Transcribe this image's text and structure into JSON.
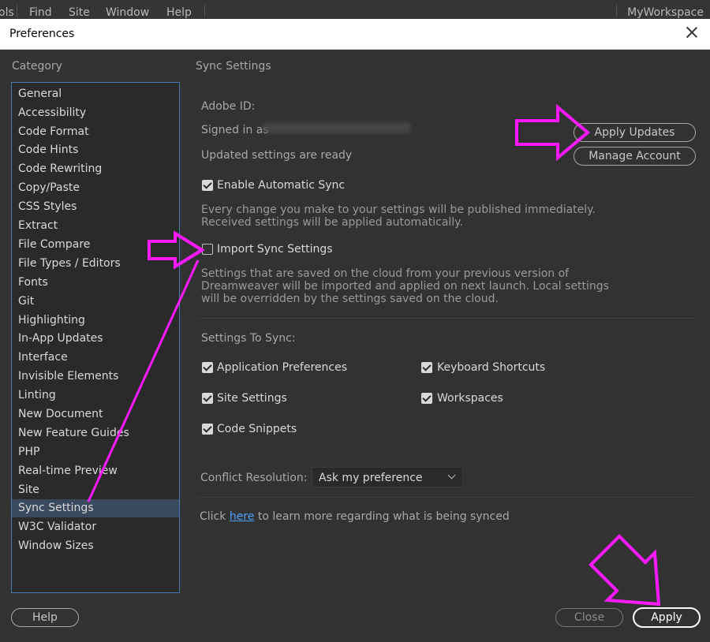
{
  "menubar": {
    "items": [
      "ols",
      "Find",
      "Site",
      "Window",
      "Help"
    ],
    "workspace": "MyWorkspace"
  },
  "dialog": {
    "title": "Preferences",
    "category_heading": "Category",
    "categories": [
      "General",
      "Accessibility",
      "Code Format",
      "Code Hints",
      "Code Rewriting",
      "Copy/Paste",
      "CSS Styles",
      "Extract",
      "File Compare",
      "File Types / Editors",
      "Fonts",
      "Git",
      "Highlighting",
      "In-App Updates",
      "Interface",
      "Invisible Elements",
      "Linting",
      "New Document",
      "New Feature Guides",
      "PHP",
      "Real-time Preview",
      "Site",
      "Sync Settings",
      "W3C Validator",
      "Window Sizes"
    ],
    "selected_category": "Sync Settings",
    "buttons": {
      "help": "Help",
      "close": "Close",
      "apply": "Apply"
    }
  },
  "sync": {
    "section_title": "Sync Settings",
    "adobe_id_label": "Adobe ID:",
    "signed_in_label": "Signed in as",
    "status": "Updated settings are ready",
    "apply_updates_button": "Apply Updates",
    "manage_account_button": "Manage Account",
    "auto_sync": {
      "label": "Enable Automatic Sync",
      "checked": true,
      "desc_line1": "Every change you make to your settings will be published immediately.",
      "desc_line2": "Received settings will be applied automatically."
    },
    "import_sync": {
      "label": "Import Sync Settings",
      "checked": false,
      "desc_line1": "Settings that are saved on the cloud from your previous version of",
      "desc_line2": "Dreamweaver will be imported and applied on next launch. Local settings",
      "desc_line3": "will be overridden by the settings saved on the cloud."
    },
    "settings_to_sync_label": "Settings To Sync:",
    "options": {
      "app_prefs": {
        "label": "Application Preferences",
        "checked": true
      },
      "keyboard": {
        "label": "Keyboard Shortcuts",
        "checked": true
      },
      "site": {
        "label": "Site Settings",
        "checked": true
      },
      "workspaces": {
        "label": "Workspaces",
        "checked": true
      },
      "snippets": {
        "label": "Code Snippets",
        "checked": true
      }
    },
    "conflict_label": "Conflict Resolution:",
    "conflict_value": "Ask my preference",
    "footer_text_before": "Click",
    "footer_link": "here",
    "footer_text_after": "to learn more regarding what is being synced"
  },
  "colors": {
    "annotation_arrow": "#ff19ff",
    "selection": "#3a4a5e",
    "link": "#4aa3ff"
  }
}
